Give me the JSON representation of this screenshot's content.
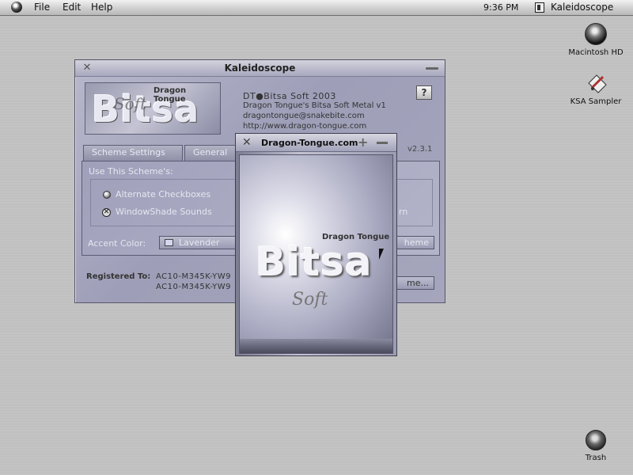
{
  "menubar": {
    "items": [
      "File",
      "Edit",
      "Help"
    ],
    "clock": "9:36 PM",
    "app_name": "Kaleidoscope"
  },
  "desktop": {
    "icons": [
      {
        "label": "Macintosh HD",
        "icon": "hard-drive-icon"
      },
      {
        "label": "KSA Sampler",
        "icon": "ksa-sampler-icon"
      },
      {
        "label": "Trash",
        "icon": "trash-icon"
      }
    ]
  },
  "main_window": {
    "title": "Kaleidoscope",
    "logo": {
      "top_text": "Dragon Tongue",
      "big_text": "Bitsa",
      "script_text": "Soft"
    },
    "info": {
      "copyright": "DT●Bitsa Soft 2003",
      "line1": "Dragon Tongue's Bitsa Soft Metal v1",
      "email": "dragontongue@snakebite.com",
      "url": "http://www.dragon-tongue.com"
    },
    "help_label": "?",
    "version": "v2.3.1",
    "tabs": [
      "Scheme Settings",
      "General"
    ],
    "group_label": "Use This Scheme's:",
    "options": [
      {
        "label": "Alternate Checkboxes",
        "checked": false
      },
      {
        "label": "WindowShade Sounds",
        "checked": true
      }
    ],
    "right_option_fragment": "rn",
    "accent": {
      "label": "Accent Color:",
      "value": "Lavender",
      "swatch_color": "#d6d6f0"
    },
    "scheme_button": "heme",
    "registered": {
      "label": "Registered To:",
      "code1": "AC10-M345K-YW9",
      "code2": "AC10-M345K-YW9"
    },
    "name_button": "me..."
  },
  "about_window": {
    "title": "Dragon-Tongue.com",
    "top_text": "Dragon Tongue",
    "big_text": "Bitsa",
    "script_text": "Soft"
  }
}
